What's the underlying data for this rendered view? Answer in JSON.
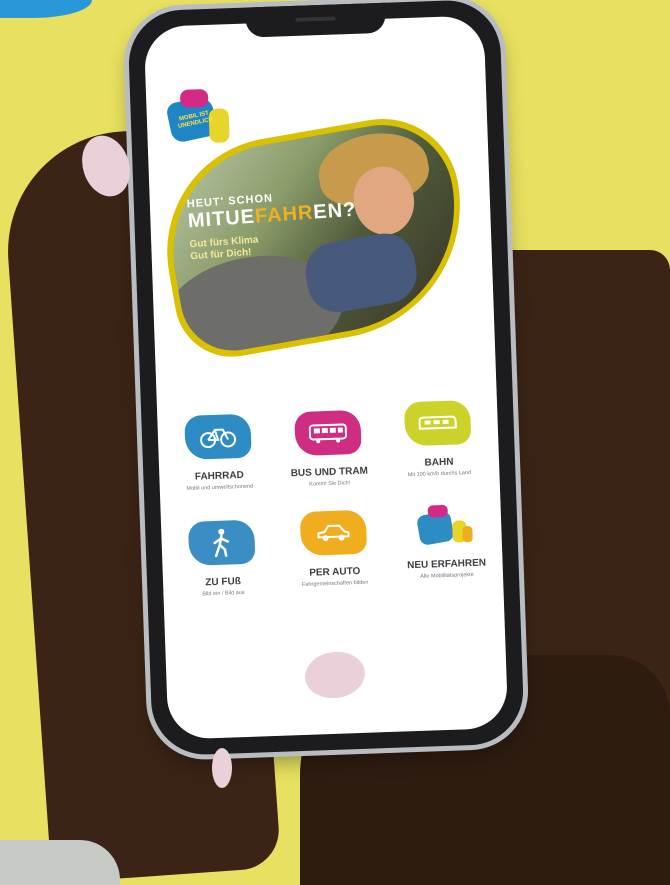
{
  "app": {
    "logo_text": "MOBIL IST UNENDLICH",
    "hero": {
      "line1": "HEUT' SCHON",
      "line2_pre": "MITUE",
      "line2_accent": "FAHR",
      "line2_post": "EN?",
      "subtitle_line1": "Gut fürs Klima",
      "subtitle_line2": "Gut für Dich!"
    }
  },
  "tiles": [
    {
      "title": "FAHRRAD",
      "subtitle": "Mobil und umweltschonend",
      "color": "#2d8cc4",
      "icon": "bicycle-icon"
    },
    {
      "title": "BUS UND TRAM",
      "subtitle": "Komm! Sie Dich!",
      "color": "#cf2d82",
      "icon": "bus-icon"
    },
    {
      "title": "BAHN",
      "subtitle": "Mit 100 km/h durchs Land",
      "color": "#ccd22a",
      "icon": "train-icon"
    },
    {
      "title": "ZU FUß",
      "subtitle": "Bild ein / Bild aus",
      "color": "#3a8ec4",
      "icon": "walking-person-icon"
    },
    {
      "title": "PER AUTO",
      "subtitle": "Fahrgemeinschaften bilden",
      "color": "#f0ad1e",
      "icon": "car-icon"
    },
    {
      "title": "NEU ERFAHREN",
      "subtitle": "Alle Mobilitätsprojekte",
      "color": "#2d8cc4",
      "icon": "logo-collage-icon"
    }
  ]
}
